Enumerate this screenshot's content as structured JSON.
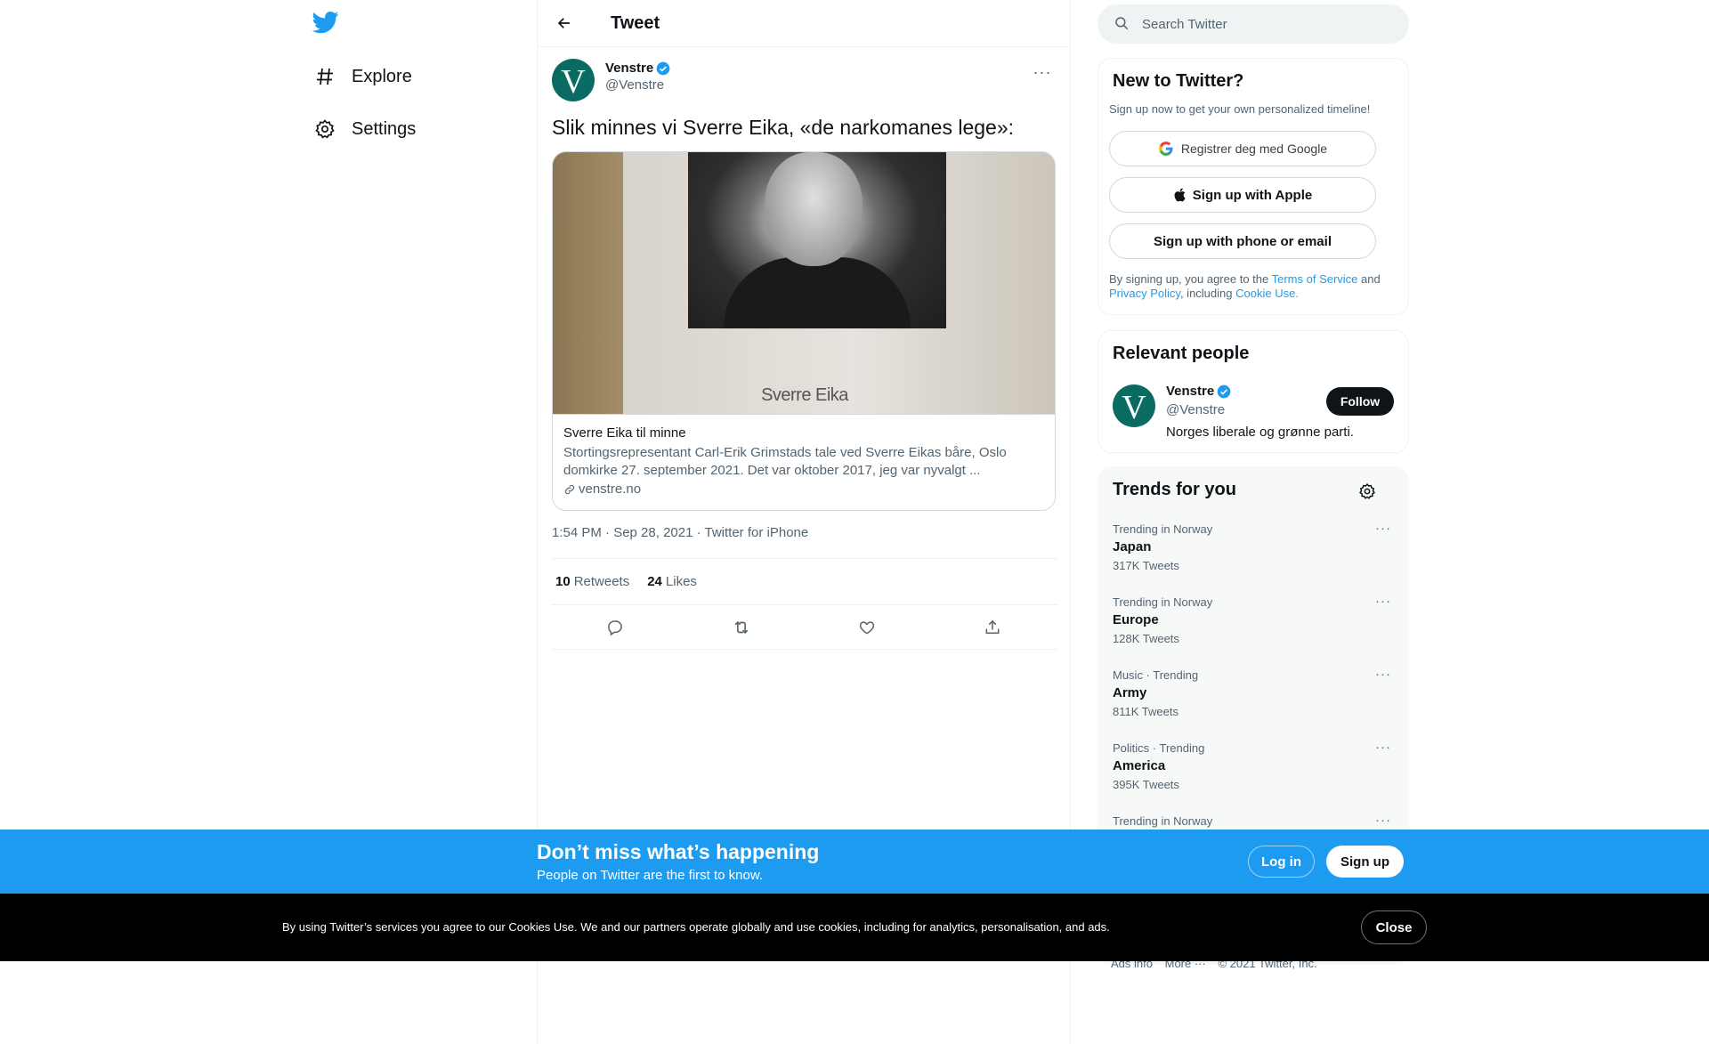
{
  "nav": {
    "items": [
      {
        "label": "Explore",
        "icon": "hashtag-icon"
      },
      {
        "label": "Settings",
        "icon": "gear-icon"
      }
    ]
  },
  "header": {
    "title": "Tweet"
  },
  "tweet": {
    "author_name": "Venstre",
    "author_handle": "@Venstre",
    "text": "Slik minnes vi Sverre Eika, «de narkomanes lege»:",
    "card": {
      "image_caption": "Sverre Eika",
      "title": "Sverre Eika til minne",
      "description": "Stortingsrepresentant Carl-Erik Grimstads tale ved Sverre Eikas båre, Oslo domkirke 27. september 2021. Det var oktober 2017, jeg var nyvalgt ...",
      "domain": "venstre.no"
    },
    "meta": "1:54 PM · Sep 28, 2021 · Twitter for iPhone",
    "retweets_count": "10",
    "retweets_label": "Retweets",
    "likes_count": "24",
    "likes_label": "Likes"
  },
  "search": {
    "placeholder": "Search Twitter"
  },
  "signup_box": {
    "title": "New to Twitter?",
    "subtitle": "Sign up now to get your own personalized timeline!",
    "google_label": "Registrer deg med Google",
    "apple_label": "Sign up with Apple",
    "phone_label": "Sign up with phone or email",
    "legal_1": "By signing up, you agree to the ",
    "terms": "Terms of Service",
    "legal_2": " and",
    "privacy": "Privacy Policy",
    "legal_3": ", including ",
    "cookie": "Cookie Use."
  },
  "relevant": {
    "title": "Relevant people",
    "name": "Venstre",
    "handle": "@Venstre",
    "bio": "Norges liberale og grønne parti.",
    "follow_label": "Follow"
  },
  "trends": {
    "title": "Trends for you",
    "items": [
      {
        "context": "Trending in Norway",
        "name": "Japan",
        "count": "317K Tweets"
      },
      {
        "context": "Trending in Norway",
        "name": "Europe",
        "count": "128K Tweets"
      },
      {
        "context": "Music · Trending",
        "name": "Army",
        "count": "811K Tweets"
      },
      {
        "context": "Politics · Trending",
        "name": "America",
        "count": "395K Tweets"
      },
      {
        "context": "Trending in Norway",
        "name": "",
        "count": ""
      }
    ]
  },
  "footer": {
    "ads_info": "Ads info",
    "more": "More ···",
    "copyright": "© 2021 Twitter, Inc."
  },
  "bottom_bar": {
    "title": "Don’t miss what’s happening",
    "subtitle": "People on Twitter are the first to know.",
    "login_label": "Log in",
    "signup_label": "Sign up"
  },
  "cookie_bar": {
    "text": "By using Twitter’s services you agree to our Cookies Use. We and our partners operate globally and use cookies, including for analytics, personalisation, and ads.",
    "close_label": "Close"
  },
  "colors": {
    "accent": "#1d9bf0",
    "text_primary": "#0f1419",
    "text_secondary": "#536471",
    "venstre_green": "#0a6b63"
  }
}
